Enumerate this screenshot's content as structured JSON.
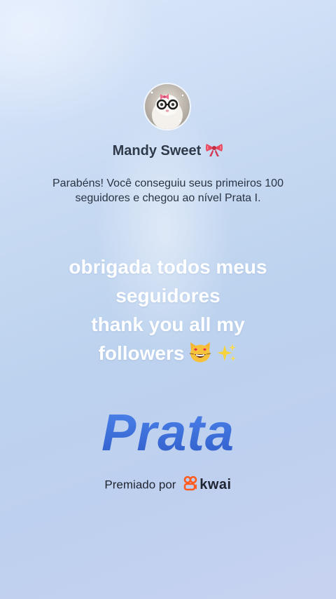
{
  "user": {
    "name": "Mandy Sweet"
  },
  "message": {
    "congrats": "Parabéns! Você conseguiu seus primeiros 100 seguidores e chegou ao nível Prata I."
  },
  "caption": {
    "line1": "obrigada todos meus",
    "line2": "seguidores",
    "line3": "thank you all my",
    "line4": "followers"
  },
  "badge": {
    "level": "Prata"
  },
  "footer": {
    "awarded_by": "Premiado por",
    "brand": "kwai"
  },
  "colors": {
    "accent": "#3a68d8",
    "kwai_brand": "#ff5a1f"
  },
  "icons": [
    "bow-emoji",
    "heart-eyes-cat-emoji",
    "sparkles-emoji",
    "kwai-logo-icon"
  ]
}
